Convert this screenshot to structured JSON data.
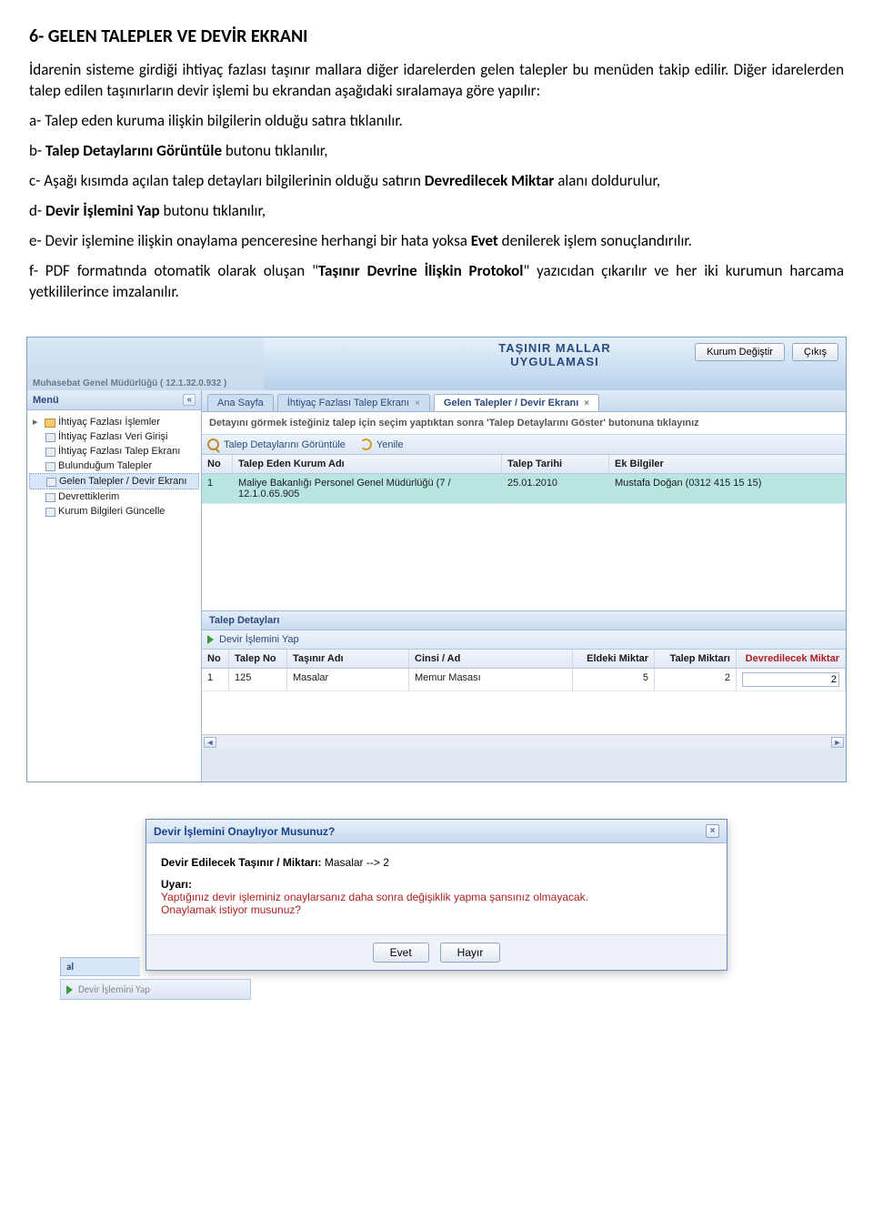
{
  "doc": {
    "title": "6- GELEN TALEPLER VE DEVİR EKRANI",
    "p1": "İdarenin sisteme girdiği ihtiyaç fazlası taşınır mallara diğer idarelerden gelen talepler bu menüden takip edilir. Diğer idarelerden talep edilen taşınırların devir işlemi bu ekrandan aşağıdaki sıralamaya göre yapılır:",
    "pa": "a- Talep eden kuruma ilişkin bilgilerin olduğu satıra tıklanılır.",
    "pb_pre": "b- ",
    "pb_bold": "Talep Detaylarını Görüntüle",
    "pb_post": " butonu tıklanılır,",
    "pc_pre": "c- Aşağı kısımda açılan talep detayları bilgilerinin olduğu satırın ",
    "pc_bold": "Devredilecek Miktar",
    "pc_post": " alanı doldurulur,",
    "pd_pre": "d- ",
    "pd_bold": "Devir İşlemini Yap",
    "pd_post": " butonu tıklanılır,",
    "pe_pre": "e- Devir işlemine ilişkin onaylama penceresine herhangi bir hata yoksa ",
    "pe_bold": "Evet",
    "pe_post": " denilerek işlem sonuçlandırılır.",
    "pf_pre": "f- PDF formatında otomatik olarak oluşan \"",
    "pf_bold": "Taşınır Devrine İlişkin Protokol",
    "pf_post": "\" yazıcıdan çıkarılır ve her iki kurumun harcama yetkililerince imzalanılır."
  },
  "app": {
    "title1": "TAŞINIR MALLAR",
    "title2": "UYGULAMASI",
    "org_label": "Muhasebat Genel Müdürlüğü ( 12.1.32.0.932 )",
    "btn_change": "Kurum Değiştir",
    "btn_exit": "Çıkış",
    "menu_title": "Menü",
    "menu_root": "İhtiyaç Fazlası İşlemler",
    "menu_items": [
      "İhtiyaç Fazlası Veri Girişi",
      "İhtiyaç Fazlası Talep Ekranı",
      "Bulunduğum Talepler",
      "Gelen Talepler / Devir Ekranı",
      "Devrettiklerim",
      "Kurum Bilgileri Güncelle"
    ],
    "tabs": {
      "t1": "Ana Sayfa",
      "t2": "İhtiyaç Fazlası Talep Ekranı",
      "t3": "Gelen Talepler / Devir Ekranı"
    },
    "instruction": "Detayını görmek isteğiniz talep için seçim yaptıktan sonra 'Talep Detaylarını Göster' butonuna tıklayınız",
    "tool_view": "Talep Detaylarını Görüntüle",
    "tool_refresh": "Yenile",
    "grid": {
      "h_no": "No",
      "h_kurum": "Talep Eden Kurum Adı",
      "h_tarih": "Talep Tarihi",
      "h_ek": "Ek Bilgiler",
      "row": {
        "no": "1",
        "kurum": "Maliye Bakanlığı Personel Genel Müdürlüğü (7 / 12.1.0.65.905",
        "tarih": "25.01.2010",
        "ek": "Mustafa Doğan (0312 415 15 15)"
      }
    },
    "section_title": "Talep Detayları",
    "detail_tool": "Devir İşlemini Yap",
    "detail": {
      "h_no": "No",
      "h_talepno": "Talep No",
      "h_ad": "Taşınır Adı",
      "h_cinsi": "Cinsi / Ad",
      "h_eldeki": "Eldeki Miktar",
      "h_talep": "Talep Miktarı",
      "h_devir": "Devredilecek Miktar",
      "row": {
        "no": "1",
        "talepno": "125",
        "ad": "Masalar",
        "cinsi": "Memur Masası",
        "eldeki": "5",
        "talep": "2",
        "devir": "2"
      }
    }
  },
  "dialog": {
    "title": "Devir İşlemini Onaylıyor Musunuz?",
    "amount_label": "Devir Edilecek Taşınır / Miktarı: ",
    "amount_value": "Masalar --> 2",
    "warn_label": "Uyarı:",
    "warn_line1": "Yaptığınız devir işleminiz onaylarsanız daha sonra değişiklik yapma şansınız olmayacak.",
    "warn_line2": "Onaylamak istiyor musunuz?",
    "btn_yes": "Evet",
    "btn_no": "Hayır",
    "frag_tab": "al",
    "frag_tool": "Devir İşlemini Yap"
  }
}
